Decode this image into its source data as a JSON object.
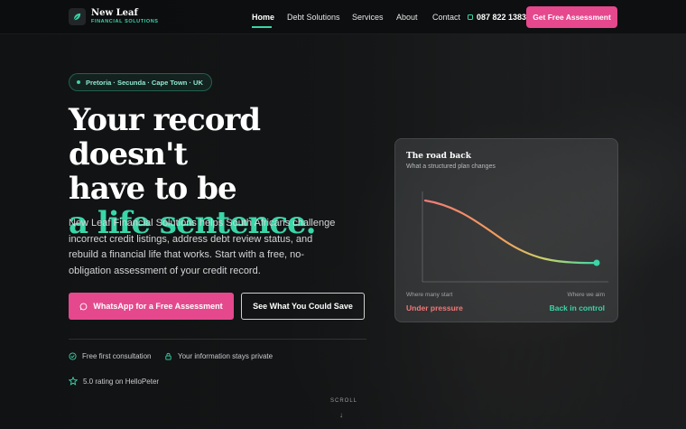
{
  "brand": {
    "name": "New Leaf",
    "tagline": "FINANCIAL SOLUTIONS"
  },
  "nav": {
    "links": [
      "Home",
      "Debt Solutions",
      "Services",
      "About",
      "Contact"
    ],
    "active": "Home",
    "phone": "087 822 1383",
    "cta": "Get Free Assessment"
  },
  "hero": {
    "locations": "Pretoria · Secunda · Cape Town · UK",
    "headline_line1": "Your record doesn't",
    "headline_line2": "have to be",
    "headline_accent": "a life sentence.",
    "lead": "New Leaf Financial Solutions helps South Africans challenge incorrect credit listings, address debt review status, and rebuild a financial life that works. Start with a free, no-obligation assessment of your credit record.",
    "primary_cta": "WhatsApp for a Free Assessment",
    "secondary_cta": "See What You Could Save",
    "features": [
      "Free first consultation",
      "Your information stays private",
      "5.0 rating on HelloPeter"
    ]
  },
  "card": {
    "title": "The road back",
    "subtitle": "What a structured plan changes",
    "start_label": "Where many start",
    "end_label": "Where we aim",
    "start_state": "Under pressure",
    "end_state": "Back in control"
  },
  "scroll_label": "SCROLL",
  "colors": {
    "accent": "#3ad6a8",
    "brand_pink": "#e5488d",
    "warning": "#f07a78"
  },
  "icons": [
    "leaf-icon",
    "phone-icon",
    "whatsapp-icon",
    "check-circle-icon",
    "lock-icon",
    "star-icon",
    "arrow-down-icon"
  ]
}
